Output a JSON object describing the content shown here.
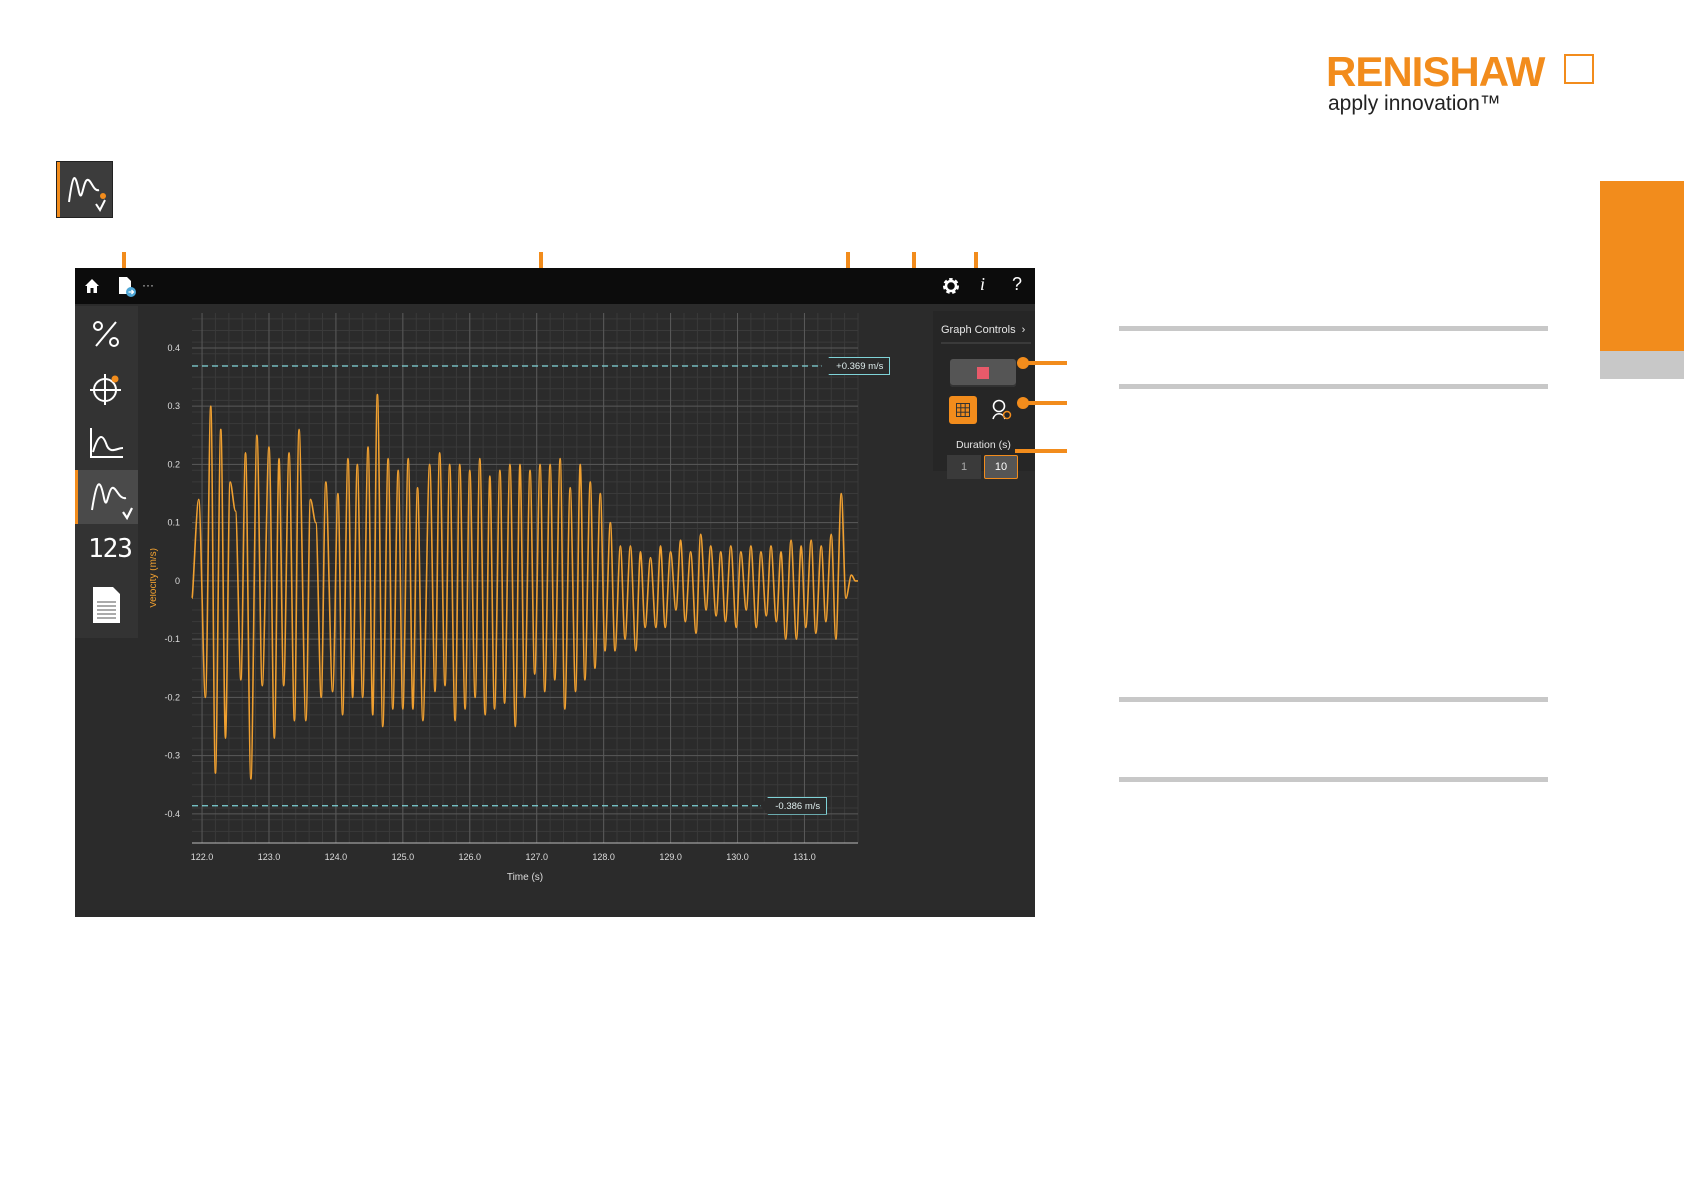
{
  "logo": {
    "brand": "RENISHAW",
    "tagline": "apply innovation™"
  },
  "colors": {
    "accent": "#f28c1c",
    "trace": "#f0a030",
    "limit_line": "#7fd3d8",
    "background": "#2b2b2b"
  },
  "topbar": {
    "menu_label": "···",
    "icons": [
      "home-icon",
      "file-export-icon",
      "gear-icon",
      "info-icon",
      "help-icon"
    ]
  },
  "sidebar": {
    "items": [
      {
        "name": "percentage",
        "icon": "percent-icon",
        "active": false
      },
      {
        "name": "target",
        "icon": "crosshair-icon",
        "active": false
      },
      {
        "name": "curve",
        "icon": "curve-icon",
        "active": false
      },
      {
        "name": "dynamic",
        "icon": "velocity-waveform-icon",
        "active": true
      },
      {
        "name": "numeric",
        "icon": "numeric-123-icon",
        "active": false
      },
      {
        "name": "report",
        "icon": "report-icon",
        "active": false
      }
    ],
    "numeric_label": "123"
  },
  "graph_controls": {
    "title": "Graph Controls",
    "duration_label": "Duration (s)",
    "duration_options": [
      "1",
      "10"
    ],
    "duration_selected": "10"
  },
  "limits": {
    "upper": "+0.369 m/s",
    "lower": "-0.386 m/s"
  },
  "chart_data": {
    "type": "line",
    "xlabel": "Time (s)",
    "ylabel": "Velocity (m/s)",
    "xlim": [
      121.85,
      131.8
    ],
    "ylim": [
      -0.45,
      0.46
    ],
    "x_ticks": [
      "122.0",
      "123.0",
      "124.0",
      "125.0",
      "126.0",
      "127.0",
      "128.0",
      "129.0",
      "130.0",
      "131.0"
    ],
    "y_ticks": [
      "0.4",
      "0.3",
      "0.2",
      "0.1",
      "0",
      "-0.1",
      "-0.2",
      "-0.3",
      "-0.4"
    ],
    "upper_limit": 0.369,
    "lower_limit": -0.386,
    "grid": true,
    "series": [
      {
        "x": [
          121.85,
          121.95,
          122.05,
          122.13,
          122.2,
          122.28,
          122.35,
          122.42,
          122.5,
          122.58,
          122.65,
          122.73,
          122.82,
          122.9,
          123.0,
          123.08,
          123.15,
          123.22,
          123.3,
          123.38,
          123.45,
          123.55,
          123.62,
          123.7,
          123.78,
          123.85,
          123.95,
          124.03,
          124.1,
          124.18,
          124.25,
          124.32,
          124.4,
          124.48,
          124.55,
          124.62,
          124.7,
          124.78,
          124.85,
          124.93,
          125.0,
          125.08,
          125.15,
          125.22,
          125.3,
          125.4,
          125.48,
          125.55,
          125.63,
          125.7,
          125.78,
          125.85,
          125.93,
          126.0,
          126.08,
          126.15,
          126.23,
          126.3,
          126.37,
          126.45,
          126.52,
          126.6,
          126.68,
          126.75,
          126.82,
          126.9,
          126.97,
          127.05,
          127.12,
          127.2,
          127.27,
          127.35,
          127.42,
          127.5,
          127.58,
          127.65,
          127.72,
          127.8,
          127.87,
          127.95,
          128.02,
          128.1,
          128.17,
          128.25,
          128.32,
          128.4,
          128.48,
          128.55,
          128.62,
          128.7,
          128.78,
          128.85,
          128.92,
          129.0,
          129.08,
          129.15,
          129.22,
          129.3,
          129.38,
          129.45,
          129.53,
          129.6,
          129.68,
          129.75,
          129.82,
          129.9,
          129.98,
          130.05,
          130.13,
          130.2,
          130.28,
          130.35,
          130.43,
          130.5,
          130.58,
          130.65,
          130.72,
          130.8,
          130.88,
          130.95,
          131.02,
          131.1,
          131.17,
          131.25,
          131.32,
          131.4,
          131.47,
          131.55,
          131.62,
          131.7,
          131.76,
          131.8
        ],
        "y": [
          -0.03,
          0.14,
          -0.2,
          0.3,
          -0.33,
          0.26,
          -0.27,
          0.17,
          0.12,
          -0.17,
          0.22,
          -0.34,
          0.25,
          -0.18,
          0.23,
          -0.27,
          0.21,
          -0.18,
          0.22,
          -0.24,
          0.26,
          -0.24,
          0.14,
          0.1,
          -0.2,
          0.17,
          -0.19,
          0.15,
          -0.23,
          0.21,
          -0.2,
          0.2,
          -0.2,
          0.23,
          -0.23,
          0.32,
          -0.25,
          0.21,
          -0.22,
          0.19,
          -0.22,
          0.21,
          -0.22,
          0.16,
          -0.24,
          0.2,
          -0.19,
          0.22,
          -0.18,
          0.2,
          -0.24,
          0.2,
          -0.22,
          0.19,
          -0.2,
          0.21,
          -0.23,
          0.18,
          -0.22,
          0.19,
          -0.21,
          0.2,
          -0.25,
          0.2,
          -0.2,
          0.19,
          -0.16,
          0.2,
          -0.19,
          0.2,
          -0.17,
          0.21,
          -0.22,
          0.16,
          -0.19,
          0.2,
          -0.17,
          0.17,
          -0.15,
          0.15,
          -0.12,
          0.1,
          -0.12,
          0.06,
          -0.1,
          0.06,
          -0.12,
          0.05,
          -0.08,
          0.04,
          -0.08,
          0.06,
          -0.08,
          0.05,
          -0.05,
          0.07,
          -0.07,
          0.05,
          -0.09,
          0.08,
          -0.05,
          0.06,
          -0.06,
          0.05,
          -0.07,
          0.06,
          -0.08,
          0.05,
          -0.05,
          0.06,
          -0.08,
          0.05,
          -0.06,
          0.06,
          -0.07,
          0.05,
          -0.1,
          0.07,
          -0.1,
          0.06,
          -0.08,
          0.07,
          -0.09,
          0.06,
          -0.07,
          0.08,
          -0.1,
          0.15,
          -0.03,
          0.01,
          0.0,
          0.0
        ]
      }
    ]
  }
}
